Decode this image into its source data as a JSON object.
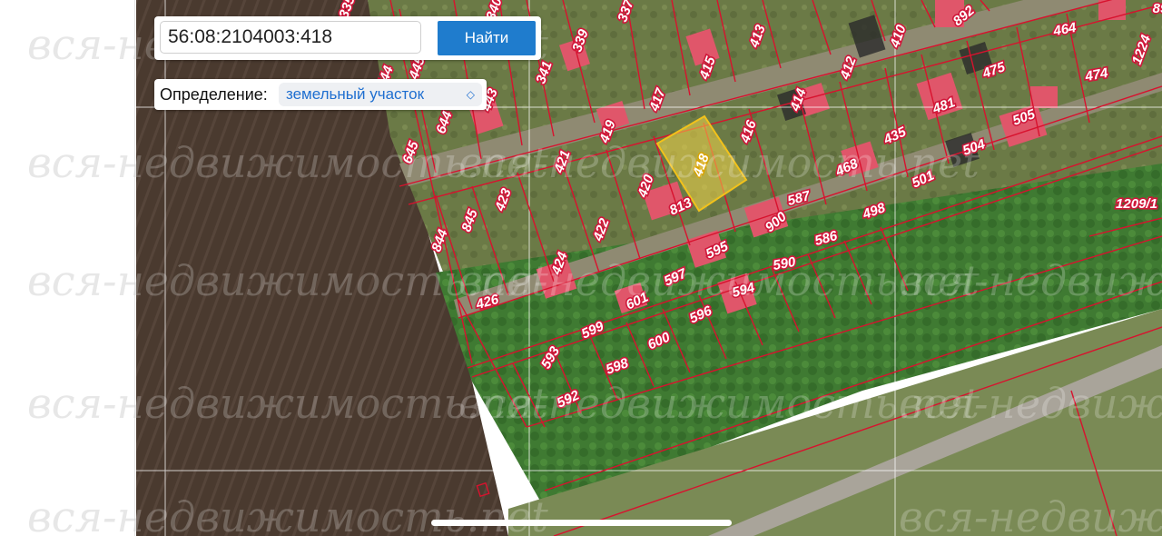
{
  "search": {
    "value": "56:08:2104003:418",
    "button_label": "Найти"
  },
  "definition": {
    "label": "Определение:",
    "selected": "земельный участок"
  },
  "watermark": "вся-недвижимость.net",
  "map": {
    "selected_parcel": "418",
    "parcel_color": "#d8122e",
    "selected_fill": "#f2d64a",
    "parcel_labels": [
      "335",
      "337",
      "340",
      "339",
      "341",
      "413",
      "415",
      "417",
      "412",
      "410",
      "414",
      "416",
      "419",
      "418",
      "420",
      "421",
      "813",
      "423",
      "422",
      "424",
      "426",
      "445",
      "444",
      "443",
      "645",
      "644",
      "844",
      "845",
      "464",
      "1224",
      "474",
      "475",
      "481",
      "505",
      "504",
      "435",
      "468",
      "501",
      "498",
      "587",
      "586",
      "590",
      "900",
      "595",
      "594",
      "597",
      "596",
      "601",
      "599",
      "600",
      "598",
      "593",
      "592",
      "1209/1",
      "892",
      "89"
    ]
  },
  "colors": {
    "accent": "#1f7ccd",
    "parcel_border": "#d8122e",
    "selected_parcel": "#f2d64a"
  }
}
